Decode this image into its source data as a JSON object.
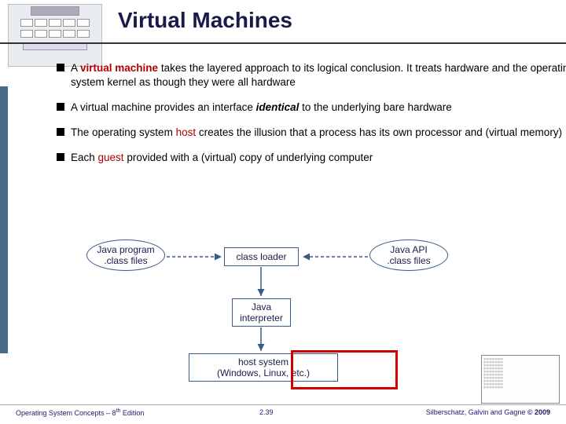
{
  "title": "Virtual Machines",
  "bullets": [
    {
      "prefix": "A ",
      "keyword": "virtual machine",
      "rest": " takes the layered approach to its logical conclusion.  It treats hardware and the operating system kernel as though they were all hardware"
    },
    {
      "prefix": "A virtual machine provides an interface ",
      "italic": "identical",
      "rest2": " to the underlying bare hardware"
    },
    {
      "prefix": "The operating system ",
      "keyword": "host",
      "rest": " creates the illusion that a process has its own processor and (virtual memory)"
    },
    {
      "prefix": "Each ",
      "keyword": "guest",
      "rest": " provided with a (virtual) copy of underlying computer"
    }
  ],
  "diagram": {
    "java_program": "Java program\n.class files",
    "class_loader": "class loader",
    "java_api": "Java API\n.class files",
    "java_interpreter": "Java\ninterpreter",
    "host_system": "host system\n(Windows, Linux, etc.)"
  },
  "footer": {
    "left_a": "Operating System Concepts – 8",
    "left_sup": "th",
    "left_b": " Edition",
    "center": "2.39",
    "right_a": "Silberschatz, Galvin and Gagne ",
    "right_b": "© 2009"
  }
}
